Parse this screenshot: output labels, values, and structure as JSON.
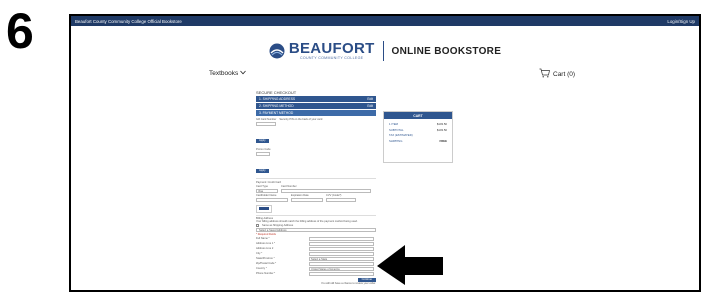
{
  "step_number": "6",
  "topbar": {
    "title": "Beaufort County Community College Official Bookstore",
    "login": "Login/Sign Up"
  },
  "header": {
    "logo_word": "BEAUFORT",
    "logo_sub": "COUNTY COMMUNITY COLLEGE",
    "store_title": "ONLINE BOOKSTORE"
  },
  "nav": {
    "textbooks": "Textbooks",
    "cart": "Cart (0)"
  },
  "checkout": {
    "title": "SECURE CHECKOUT",
    "steps": [
      {
        "label": "1. SHIPPING ADDRESS",
        "action": "Edit"
      },
      {
        "label": "2. SHIPPING METHOD",
        "action": "Edit"
      },
      {
        "label": "3. PAYMENT METHOD",
        "action": ""
      }
    ],
    "gift_card_label": "Gift Card Number",
    "gift_card_hint": "Security PIN on the back of your card",
    "apply_label": "Apply",
    "promo_label": "Promo Code",
    "apply2_label": "Apply",
    "payment_label": "Payment: Credit Card",
    "card_type_label": "Card Type",
    "card_type_value": "Visa",
    "card_number_label": "Card Number",
    "cardholder_label": "Cardholder Name",
    "expiration_label": "Expiration Date",
    "cvv_label": "CVV (Code?)",
    "billing_title": "Billing Address",
    "billing_note": "Your billing address should match the billing address of the payment method being used.",
    "same_as_shipping": "Same as Shipping Address",
    "select_saved": "Select a Saved Address",
    "required_note": "* Required Fields",
    "full_name": "Full Name *",
    "address1": "Address Line 1 *",
    "address2": "Address Line 2",
    "city": "City *",
    "state": "State/Province *",
    "state_value": "Select a State",
    "postal": "Zip/Postal Code *",
    "country": "Country *",
    "country_value": "United States of America",
    "phone": "Phone Number *",
    "continue_label": "Continue",
    "review_note": "You will still have a chance to review your order."
  },
  "cart": {
    "title": "CART",
    "lines": [
      {
        "label": "1 ITEM",
        "value": "$103.50"
      },
      {
        "label": "SUBTOTAL",
        "value": "$103.50"
      },
      {
        "label": "TAX (ESTIMATED)",
        "value": ""
      },
      {
        "label": "SHIPPING",
        "value": "FREE"
      }
    ]
  },
  "colors": {
    "brand": "#2f568f",
    "topbar": "#1f3a66"
  },
  "icons": {
    "cart": "cart-icon",
    "chevron": "chevron-down-icon",
    "logo": "beaufort-logo-icon",
    "arrow": "pointer-arrow-icon"
  }
}
